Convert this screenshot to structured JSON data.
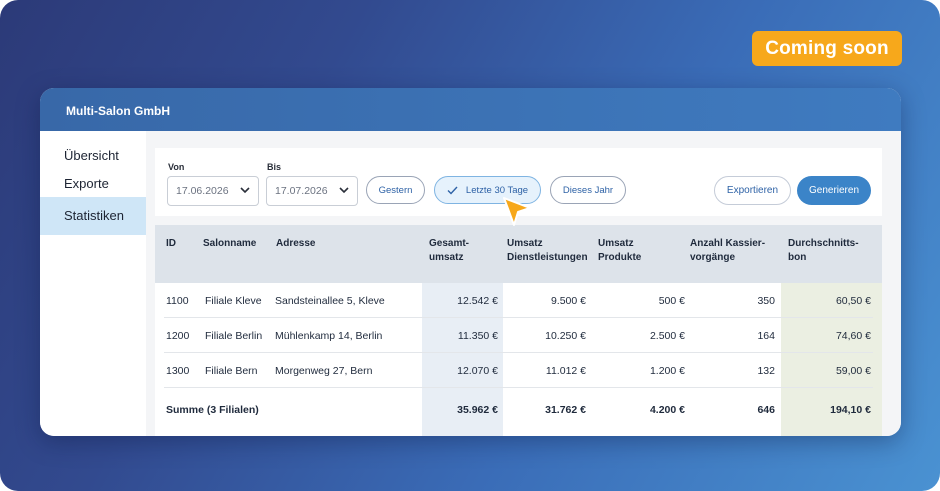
{
  "badge": {
    "label": "Coming soon",
    "color": "#f7a81b"
  },
  "window": {
    "title": "Multi-Salon GmbH"
  },
  "sidebar": {
    "items": [
      {
        "label": "Übersicht",
        "active": false
      },
      {
        "label": "Exporte",
        "active": false
      },
      {
        "label": "Statistiken",
        "active": true
      }
    ]
  },
  "filters": {
    "from_label": "Von",
    "from_value": "17.06.2026",
    "to_label": "Bis",
    "to_value": "17.07.2026",
    "presets": [
      {
        "label": "Gestern",
        "selected": false
      },
      {
        "label": "Letzte 30 Tage",
        "selected": true
      },
      {
        "label": "Dieses Jahr",
        "selected": false
      }
    ],
    "export_label": "Exportieren",
    "generate_label": "Generieren"
  },
  "table": {
    "headers": {
      "id": "ID",
      "salon": "Salonname",
      "address": "Adresse",
      "total_1": "Gesamt-",
      "total_2": "umsatz",
      "services_1": "Umsatz",
      "services_2": "Dienstleistungen",
      "products_1": "Umsatz",
      "products_2": "Produkte",
      "transactions_1": "Anzahl Kassier-",
      "transactions_2": "vorgänge",
      "avg_1": "Durchschnitts-",
      "avg_2": "bon"
    },
    "rows": [
      {
        "id": "1100",
        "salon": "Filiale Kleve",
        "address": "Sandsteinallee 5, Kleve",
        "total": "12.542 €",
        "services": "9.500 €",
        "products": "500 €",
        "transactions": "350",
        "avg": "60,50 €"
      },
      {
        "id": "1200",
        "salon": "Filiale Berlin",
        "address": "Mühlenkamp 14, Berlin",
        "total": "11.350 €",
        "services": "10.250 €",
        "products": "2.500 €",
        "transactions": "164",
        "avg": "74,60 €"
      },
      {
        "id": "1300",
        "salon": "Filiale Bern",
        "address": "Morgenweg 27, Bern",
        "total": "12.070 €",
        "services": "11.012 €",
        "products": "1.200 €",
        "transactions": "132",
        "avg": "59,00 €"
      }
    ],
    "sum": {
      "label": "Summe (3 Filialen)",
      "total": "35.962 €",
      "services": "31.762 €",
      "products": "4.200 €",
      "transactions": "646",
      "avg": "194,10 €"
    }
  },
  "icons": {
    "chevron": "chevron-down-icon",
    "check": "check-icon",
    "cursor": "pointer-cursor-icon"
  },
  "colors": {
    "accent": "#3b84c8",
    "cursor": "#f7a81b"
  }
}
